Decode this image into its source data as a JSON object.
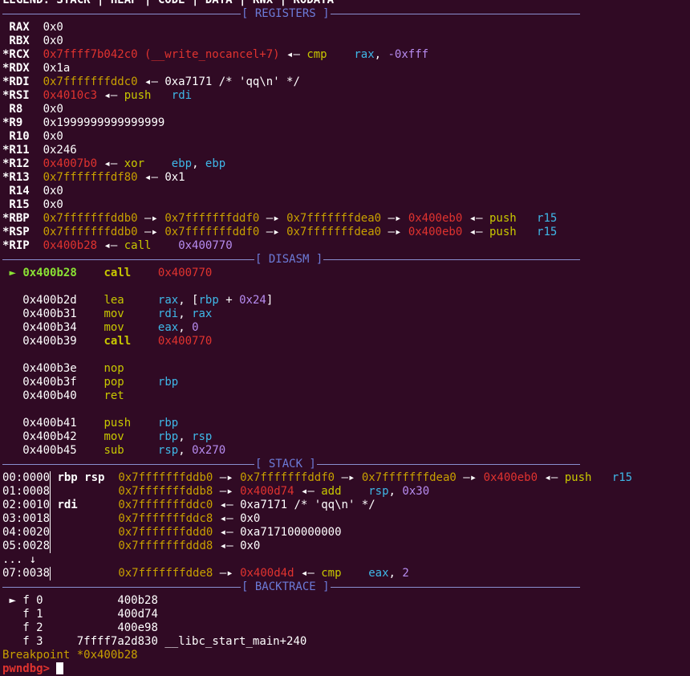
{
  "legend": "LEGEND: STACK | HEAP | CODE | DATA | RWX | RODATA",
  "sections": {
    "registers": "[ REGISTERS ]",
    "disasm": "[ DISASM ]",
    "stack": "[ STACK ]",
    "backtrace": "[ BACKTRACE ]"
  },
  "registers": {
    "rax": {
      "name": " RAX",
      "value": "0x0"
    },
    "rbx": {
      "name": " RBX",
      "value": "0x0"
    },
    "rcx": {
      "name": "*RCX",
      "value": "0x7ffff7b042c0 (__write_nocancel+7)",
      "ins": "cmp",
      "op1": "rax",
      "comma": ", ",
      "op2": "-0xfff"
    },
    "rdx": {
      "name": "*RDX",
      "value": "0x1a"
    },
    "rdi": {
      "name": "*RDI",
      "value": "0x7fffffffddc0",
      "deref": "0xa7171 /* 'qq\\n' */"
    },
    "rsi": {
      "name": "*RSI",
      "value": "0x4010c3",
      "ins": "push",
      "op1": "rdi"
    },
    "r8": {
      "name": " R8",
      "value": "0x0"
    },
    "r9": {
      "name": "*R9",
      "value": "0x1999999999999999"
    },
    "r10": {
      "name": " R10",
      "value": "0x0"
    },
    "r11": {
      "name": "*R11",
      "value": "0x246"
    },
    "r12": {
      "name": "*R12",
      "value": "0x4007b0",
      "ins": "xor",
      "op1": "ebp",
      "comma": ", ",
      "op2": "ebp"
    },
    "r13": {
      "name": "*R13",
      "value": "0x7fffffffdf80",
      "deref": "0x1"
    },
    "r14": {
      "name": " R14",
      "value": "0x0"
    },
    "r15": {
      "name": " R15",
      "value": "0x0"
    },
    "rbp": {
      "name": "*RBP",
      "v1": "0x7fffffffddb0",
      "v2": "0x7fffffffddf0",
      "v3": "0x7fffffffdea0",
      "v4": "0x400eb0",
      "ins": "push",
      "op1": "r15"
    },
    "rsp": {
      "name": "*RSP",
      "v1": "0x7fffffffddb0",
      "v2": "0x7fffffffddf0",
      "v3": "0x7fffffffdea0",
      "v4": "0x400eb0",
      "ins": "push",
      "op1": "r15"
    },
    "rip": {
      "name": "*RIP",
      "value": "0x400b28",
      "ins": "call",
      "op1": "0x400770"
    }
  },
  "arrows": {
    "right": "—▸",
    "left": "◂—"
  },
  "disasm": {
    "current": {
      "marker": "►",
      "addr": "0x400b28",
      "ins": "call",
      "target": "0x400770"
    },
    "l1": {
      "addr": "0x400b2d",
      "ins": "lea",
      "a": "rax",
      "b": "[rbp + 0x24]"
    },
    "l2": {
      "addr": "0x400b31",
      "ins": "mov",
      "a": "rdi",
      "b": "rax"
    },
    "l3": {
      "addr": "0x400b34",
      "ins": "mov",
      "a": "eax",
      "b": "0"
    },
    "l4": {
      "addr": "0x400b39",
      "ins": "call",
      "target": "0x400770"
    },
    "l5": {
      "addr": "0x400b3e",
      "ins": "nop"
    },
    "l6": {
      "addr": "0x400b3f",
      "ins": "pop",
      "a": "rbp"
    },
    "l7": {
      "addr": "0x400b40",
      "ins": "ret"
    },
    "l8": {
      "addr": "0x400b41",
      "ins": "push",
      "a": "rbp"
    },
    "l9": {
      "addr": "0x400b42",
      "ins": "mov",
      "a": "rbp",
      "b": "rsp"
    },
    "l10": {
      "addr": "0x400b45",
      "ins": "sub",
      "a": "rsp",
      "b": "0x270"
    }
  },
  "stack": {
    "s0": {
      "off": "00:0000",
      "regs": "rbp rsp",
      "v1": "0x7fffffffddb0",
      "v2": "0x7fffffffddf0",
      "v3": "0x7fffffffdea0",
      "v4": "0x400eb0",
      "ins": "push",
      "op": "r15"
    },
    "s1": {
      "off": "01:0008",
      "v1": "0x7fffffffddb8",
      "v2": "0x400d74",
      "ins": "add",
      "a": "rsp",
      "b": "0x30"
    },
    "s2": {
      "off": "02:0010",
      "regs": "rdi",
      "v1": "0x7fffffffddc0",
      "deref": "0xa7171 /* 'qq\\n' */"
    },
    "s3": {
      "off": "03:0018",
      "v1": "0x7fffffffddc8",
      "deref": "0x0"
    },
    "s4": {
      "off": "04:0020",
      "v1": "0x7fffffffddd0",
      "deref": "0xa717100000000"
    },
    "s5": {
      "off": "05:0028",
      "v1": "0x7fffffffddd8",
      "deref": "0x0"
    },
    "skip": "... ↓",
    "s7": {
      "off": "07:0038",
      "v1": "0x7fffffffdde8",
      "v2": "0x400d4d",
      "ins": "cmp",
      "a": "eax",
      "b": "2"
    }
  },
  "backtrace": {
    "marker": "►",
    "f0": {
      "frame": "f 0",
      "addr": "400b28"
    },
    "f1": {
      "frame": "f 1",
      "addr": "400d74"
    },
    "f2": {
      "frame": "f 2",
      "addr": "400e98"
    },
    "f3": {
      "frame": "f 3",
      "addr": "7ffff7a2d830 __libc_start_main+240"
    }
  },
  "status": "Breakpoint *0x400b28",
  "prompt": "pwndbg>"
}
